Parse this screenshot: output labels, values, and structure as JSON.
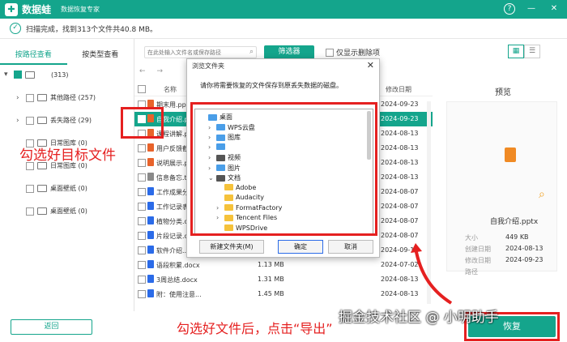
{
  "app": {
    "name": "数据蛙",
    "subtitle": "数据恢复专家",
    "help": "?",
    "minimize": "—",
    "close": "✕"
  },
  "status": {
    "text": "扫描完成，找到313个文件共40.8 MB。"
  },
  "tabs": [
    "按路径查看",
    "按类型查看"
  ],
  "toolbar": {
    "search_placeholder": "在此处输入文件名或保存路径",
    "filter_label": "筛选器",
    "only_deleted_label": "仅显示删除项"
  },
  "tree": {
    "root_count": "(313)",
    "items": [
      {
        "label": "其他路径 (257)",
        "expandable": true
      },
      {
        "label": "丢失路径 (29)",
        "expandable": true
      },
      {
        "label": "日常图库 (0)",
        "expandable": false
      },
      {
        "label": "日常图库 (0)",
        "expandable": false
      },
      {
        "label": "桌面壁纸 (0)",
        "expandable": false
      },
      {
        "label": "桌面壁纸 (0)",
        "expandable": false
      }
    ]
  },
  "list": {
    "header": {
      "name": "名称",
      "date": "修改日期"
    },
    "rows": [
      {
        "name": "期末用.pptx",
        "size": "",
        "date": "2024-09-23",
        "color": "#e8632b",
        "selected": false
      },
      {
        "name": "自我介绍.pptx",
        "size": "",
        "date": "2024-09-23",
        "color": "#e8632b",
        "selected": true
      },
      {
        "name": "课程讲解.p...",
        "size": "",
        "date": "2024-08-13",
        "color": "#e8632b",
        "selected": false
      },
      {
        "name": "用户反馈截...",
        "size": "",
        "date": "2024-08-13",
        "color": "#e8632b",
        "selected": false
      },
      {
        "name": "说明展示.p...",
        "size": "",
        "date": "2024-08-13",
        "color": "#e8632b",
        "selected": false
      },
      {
        "name": "信息备忘.t...",
        "size": "",
        "date": "2024-08-13",
        "color": "#8a8a8a",
        "selected": false
      },
      {
        "name": "工作成果分...",
        "size": "",
        "date": "2024-08-07",
        "color": "#2b6be8",
        "selected": false
      },
      {
        "name": "工作记录表...",
        "size": "",
        "date": "2024-08-07",
        "color": "#2b6be8",
        "selected": false
      },
      {
        "name": "植物分类.d...",
        "size": "",
        "date": "2024-08-07",
        "color": "#2b6be8",
        "selected": false
      },
      {
        "name": "片段记录.d...",
        "size": "",
        "date": "2024-08-07",
        "color": "#2b6be8",
        "selected": false
      },
      {
        "name": "软件介绍...",
        "size": "",
        "date": "2024-09-11",
        "color": "#2b6be8",
        "selected": false
      },
      {
        "name": "语段积累.docx",
        "size": "1.13 MB",
        "date": "2024-07-02",
        "color": "#2b6be8",
        "selected": false
      },
      {
        "name": "3周总结.docx",
        "size": "1.31 MB",
        "date": "2024-08-13",
        "color": "#2b6be8",
        "selected": false
      },
      {
        "name": "附：使用注意...",
        "size": "1.45 MB",
        "date": "2024-08-13",
        "color": "#2b6be8",
        "selected": false
      }
    ]
  },
  "preview": {
    "title": "预览",
    "filename": "自我介绍.pptx",
    "meta": [
      {
        "label": "大小",
        "value": "449 KB"
      },
      {
        "label": "创建日期",
        "value": "2024-08-13"
      },
      {
        "label": "修改日期",
        "value": "2024-09-23"
      },
      {
        "label": "路径",
        "value": ""
      }
    ]
  },
  "dialog": {
    "title": "浏览文件夹",
    "close": "✕",
    "message": "请你将需要恢复的文件保存到原丢失数据的磁盘。",
    "tree": [
      {
        "label": "桌面",
        "indent": 0,
        "arrow": "",
        "color": "blue"
      },
      {
        "label": "WPS云盘",
        "indent": 1,
        "arrow": "›",
        "color": "blue"
      },
      {
        "label": "图库",
        "indent": 1,
        "arrow": "›",
        "color": "blue"
      },
      {
        "label": "",
        "indent": 1,
        "arrow": "›",
        "color": "blue"
      },
      {
        "label": "视频",
        "indent": 1,
        "arrow": "›",
        "color": "dark"
      },
      {
        "label": "图片",
        "indent": 1,
        "arrow": "›",
        "color": "blue"
      },
      {
        "label": "文档",
        "indent": 1,
        "arrow": "⌄",
        "color": "dark"
      },
      {
        "label": "Adobe",
        "indent": 2,
        "arrow": "",
        "color": "yellow"
      },
      {
        "label": "Audacity",
        "indent": 2,
        "arrow": "",
        "color": "yellow"
      },
      {
        "label": "FormatFactory",
        "indent": 2,
        "arrow": "›",
        "color": "yellow"
      },
      {
        "label": "Tencent Files",
        "indent": 2,
        "arrow": "›",
        "color": "yellow"
      },
      {
        "label": "WPSDrive",
        "indent": 2,
        "arrow": "",
        "color": "yellow"
      }
    ],
    "new_folder": "新建文件夹(M)",
    "ok": "确定",
    "cancel": "取消"
  },
  "annotations": {
    "left": "勾选好目标文件",
    "bottom": "勾选好文件后，点击“导出”"
  },
  "bottom": {
    "back": "返回",
    "recover": "恢复"
  },
  "watermark": "掘金技术社区 @ 小明助手",
  "colors": {
    "accent": "#14a58c",
    "annotation": "#e52020"
  }
}
